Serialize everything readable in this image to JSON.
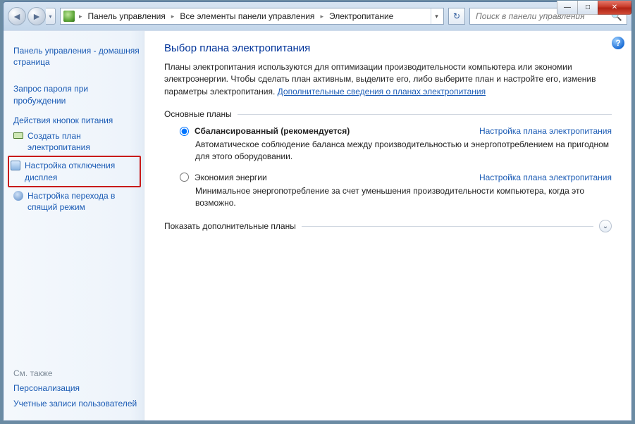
{
  "window_controls": {
    "minimize": "—",
    "maximize": "□",
    "close": "✕"
  },
  "nav": {
    "back": "◄",
    "forward": "►",
    "history_drop": "▾",
    "refresh": "↻"
  },
  "breadcrumbs": [
    "Панель управления",
    "Все элементы панели управления",
    "Электропитание"
  ],
  "search": {
    "placeholder": "Поиск в панели управления",
    "icon": "🔍"
  },
  "help_icon": "?",
  "sidebar": {
    "home": "Панель управления - домашняя страница",
    "items": [
      {
        "label": "Запрос пароля при пробуждении"
      },
      {
        "label": "Действия кнопок питания"
      },
      {
        "label": "Создать план электропитания"
      },
      {
        "label": "Настройка отключения дисплея",
        "highlighted": true
      },
      {
        "label": "Настройка перехода в спящий режим"
      }
    ],
    "see_also_h": "См. также",
    "see_also": [
      "Персонализация",
      "Учетные записи пользователей"
    ]
  },
  "main": {
    "title": "Выбор плана электропитания",
    "intro_pre": "Планы электропитания используются для оптимизации производительности компьютера или экономии электроэнергии. Чтобы сделать план активным, выделите его, либо выберите план и настройте его, изменив параметры электропитания. ",
    "intro_link": "Дополнительные сведения о планах электропитания",
    "basic_plans_legend": "Основные планы",
    "plans": [
      {
        "name": "Сбалансированный (рекомендуется)",
        "selected": true,
        "link": "Настройка плана электропитания",
        "desc": "Автоматическое соблюдение баланса между производительностью и энергопотреблением на пригодном для этого оборудовании."
      },
      {
        "name": "Экономия энергии",
        "selected": false,
        "link": "Настройка плана электропитания",
        "desc": "Минимальное энергопотребление за счет уменьшения производительности компьютера, когда это возможно."
      }
    ],
    "show_more": "Показать дополнительные планы"
  }
}
